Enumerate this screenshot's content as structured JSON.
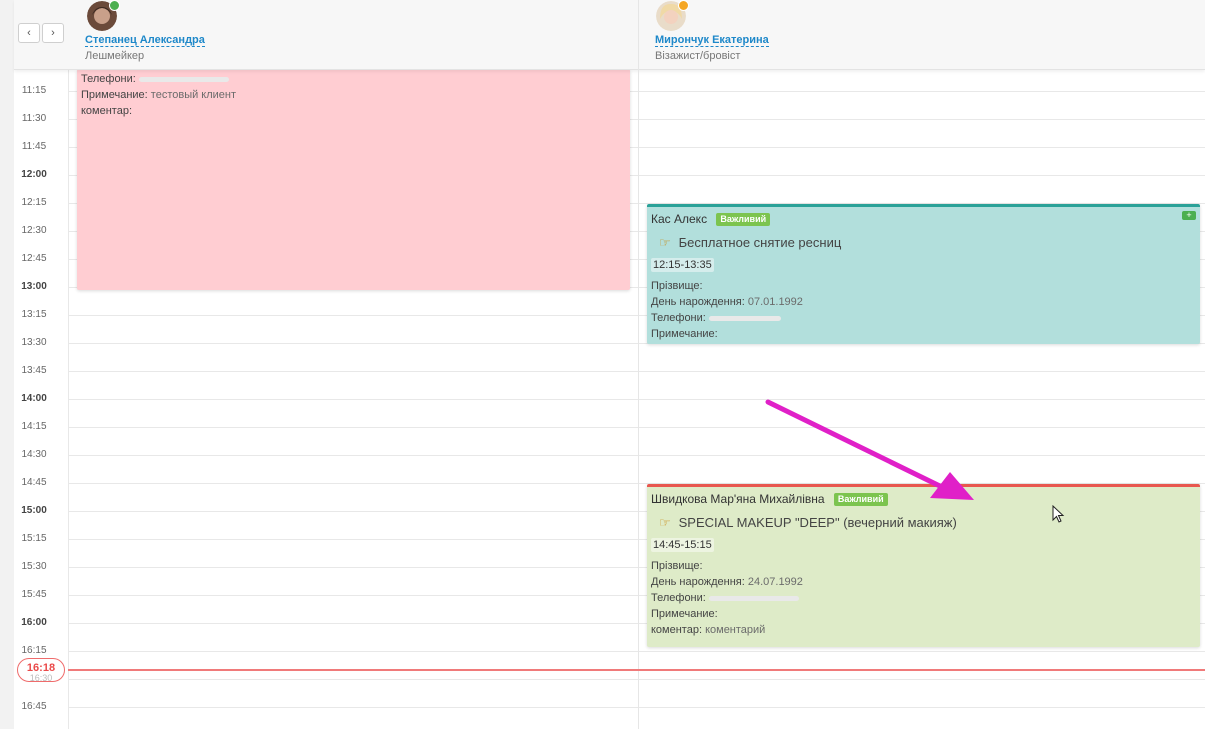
{
  "nav": {
    "prev_label": "‹",
    "next_label": "›"
  },
  "staff": [
    {
      "name": "Степанец Александра",
      "role": "Лешмейкер",
      "status_color": "#4caf50"
    },
    {
      "name": "Мирончук Екатерина",
      "role": "Візажист/бровіст",
      "status_color": "#f5a623"
    }
  ],
  "time_slots": [
    {
      "label": "11:15",
      "hour": false
    },
    {
      "label": "11:30",
      "hour": false
    },
    {
      "label": "11:45",
      "hour": false
    },
    {
      "label": "12:00",
      "hour": true
    },
    {
      "label": "12:15",
      "hour": false
    },
    {
      "label": "12:30",
      "hour": false
    },
    {
      "label": "12:45",
      "hour": false
    },
    {
      "label": "13:00",
      "hour": true
    },
    {
      "label": "13:15",
      "hour": false
    },
    {
      "label": "13:30",
      "hour": false
    },
    {
      "label": "13:45",
      "hour": false
    },
    {
      "label": "14:00",
      "hour": true
    },
    {
      "label": "14:15",
      "hour": false
    },
    {
      "label": "14:30",
      "hour": false
    },
    {
      "label": "14:45",
      "hour": false
    },
    {
      "label": "15:00",
      "hour": true
    },
    {
      "label": "15:15",
      "hour": false
    },
    {
      "label": "15:30",
      "hour": false
    },
    {
      "label": "15:45",
      "hour": false
    },
    {
      "label": "16:00",
      "hour": true
    },
    {
      "label": "16:15",
      "hour": false
    },
    {
      "label": "16:30",
      "hour": false
    },
    {
      "label": "16:45",
      "hour": false
    }
  ],
  "current_time": {
    "label": "16:18",
    "sub_label": "16:30"
  },
  "appt1": {
    "phone_label": "Телефони:",
    "note_label": "Примечание:",
    "note_value": "тестовый клиент",
    "comment_label": "коментар:"
  },
  "appt2": {
    "client": "Кас Алекс",
    "badge": "Важливий",
    "service": "Бесплатное снятие ресниц",
    "time": "12:15-13:35",
    "surname_label": "Прізвище:",
    "birthday_label": "День нарождення:",
    "birthday_value": "07.01.1992",
    "phone_label": "Телефони:",
    "note_label": "Примечание:",
    "top_color": "#2aa198",
    "bg_color": "#b2dfdc"
  },
  "appt3": {
    "client": "Швидкова Мар'яна Михайлівна",
    "badge": "Важливий",
    "service": "SPECIAL MAKEUP \"DEEP\" (вечерний макияж)",
    "time": "14:45-15:15",
    "surname_label": "Прізвище:",
    "birthday_label": "День нарождення:",
    "birthday_value": "24.07.1992",
    "phone_label": "Телефони:",
    "note_label": "Примечание:",
    "comment_label": "коментар:",
    "comment_value": "коментарий",
    "top_color": "#e8574f",
    "bg_color": "#deebc8"
  },
  "appt1_color": "#ffcdd2",
  "annotation_arrow_color": "#e020c8"
}
